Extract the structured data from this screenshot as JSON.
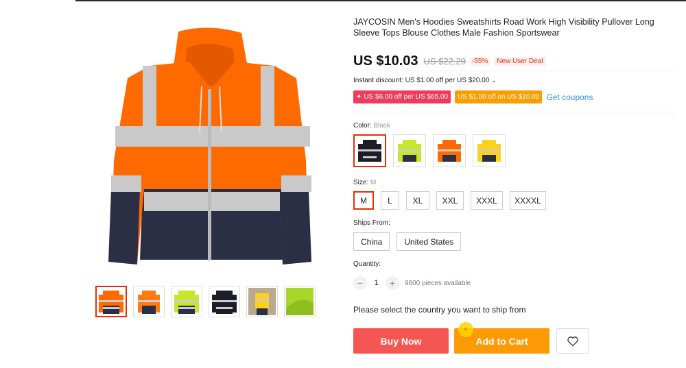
{
  "product": {
    "title": "JAYCOSIN Men's Hoodies Sweatshirts Road Work High Visibility Pullover Long Sleeve Tops Blouse Clothes Male Fashion Sportswear",
    "price": "US $10.03",
    "original_price": "US $22.29",
    "discount_pct": "-55%",
    "deal_badge": "New User Deal",
    "instant_discount": "Instant discount: US $1.00 off per US $20.00",
    "coupon_red": "US $6.00 off per US $65.00",
    "coupon_orange": "US $1.00 off on US $10.00",
    "get_coupons": "Get coupons"
  },
  "color": {
    "label": "Color:",
    "selected": "Black",
    "options": [
      "black",
      "lime",
      "orange",
      "yellow"
    ]
  },
  "size": {
    "label": "Size:",
    "selected": "M",
    "options": [
      "M",
      "L",
      "XL",
      "XXL",
      "XXXL",
      "XXXXL"
    ]
  },
  "ships_from": {
    "label": "Ships From:",
    "options": [
      "China",
      "United States"
    ]
  },
  "quantity": {
    "label": "Quantity:",
    "minus": "−",
    "value": "1",
    "plus": "+",
    "available": "9600 pieces available"
  },
  "ship_message": "Please select the country you want to ship from",
  "actions": {
    "buy_now": "Buy Now",
    "add_to_cart": "Add to Cart",
    "wishlist_icon": "heart-icon"
  },
  "gallery": {
    "thumbnails": [
      "orange-front",
      "orange-back",
      "lime-front",
      "black-front",
      "yellow-model",
      "fabric-closeup"
    ],
    "active_index": 0
  },
  "colors": {
    "accent": "#e62e04",
    "buy": "#f55652",
    "cart": "#ff9a07",
    "coupon_red": "#f23a5d",
    "coupon_orange": "#ff9c00",
    "link": "#3a8cd8",
    "hoodie_orange": "#ff6a00",
    "hoodie_navy": "#2a2f45",
    "reflective": "#c9c9c9"
  }
}
